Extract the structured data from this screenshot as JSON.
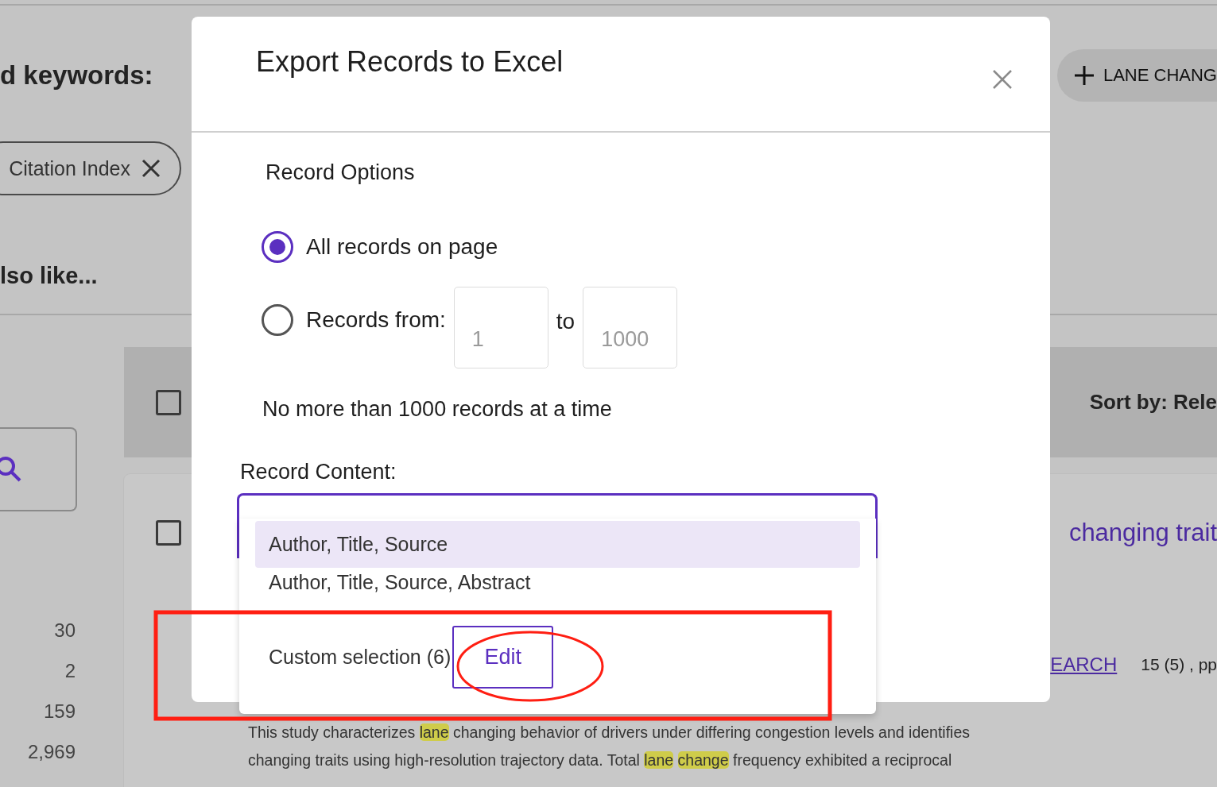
{
  "background": {
    "keywords_label": "d keywords:",
    "add_keyword_button": "LANE CHANG",
    "filter_chip": "Citation Index",
    "also_like": "lso like...",
    "counts": [
      "30",
      "2",
      "159",
      "2,969"
    ],
    "select_all_checked": false,
    "sort_label": "Sort by: Rele",
    "result": {
      "checked": false,
      "title": "changing trait",
      "source": "EARCH",
      "pages": "15 (5) , pp",
      "abstract_lines": [
        [
          {
            "text": "This study characterizes ",
            "highlight": false
          },
          {
            "text": "lane",
            "highlight": true
          },
          {
            "text": " changing behavior of drivers under differing congestion levels and identifies",
            "highlight": false
          }
        ],
        [
          {
            "text": "changing traits using high-resolution trajectory data. Total ",
            "highlight": false
          },
          {
            "text": "lane ",
            "highlight": true
          },
          {
            "text": "change",
            "highlight": true
          },
          {
            "text": " frequency exhibited a reciprocal",
            "highlight": false
          }
        ]
      ]
    }
  },
  "dialog": {
    "title": "Export Records to Excel",
    "record_options_label": "Record Options",
    "options": [
      {
        "label": "All records on page",
        "selected": true
      },
      {
        "label": "Records from:",
        "selected": false
      }
    ],
    "range": {
      "from": {
        "value": "1",
        "disabled": true
      },
      "to_label": "to",
      "to": {
        "value": "1000",
        "disabled": true
      }
    },
    "limit_note": "No more than 1000 records at a time",
    "record_content_label": "Record Content:",
    "content_dropdown": {
      "expanded": true,
      "options": [
        {
          "kind": "plain",
          "label": "Author, Title, Source",
          "selected": true
        },
        {
          "kind": "plain",
          "label": "Author, Title, Source, Abstract",
          "selected": false
        },
        {
          "kind": "custom",
          "label": "Custom selection (6)",
          "selected": false,
          "edit_button": "Edit"
        }
      ]
    }
  },
  "annotations": [
    {
      "kind": "rectangle"
    },
    {
      "kind": "ellipse"
    }
  ]
}
